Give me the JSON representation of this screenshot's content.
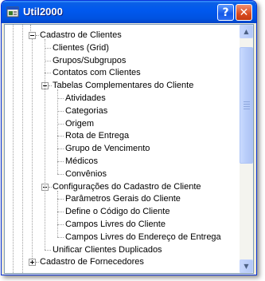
{
  "window": {
    "title": "Util2000",
    "help_label": "?",
    "close_label": "✕"
  },
  "colors": {
    "titlebar": "#0058ee",
    "tree_bg": "#ffffff",
    "lines": "#a0a0a0"
  },
  "tree": {
    "items": [
      {
        "label": "Cadastro de Clientes",
        "level": 0,
        "expander": "minus"
      },
      {
        "label": "Clientes (Grid)",
        "level": 1,
        "expander": ""
      },
      {
        "label": "Grupos/Subgrupos",
        "level": 1,
        "expander": ""
      },
      {
        "label": "Contatos com Clientes",
        "level": 1,
        "expander": ""
      },
      {
        "label": "Tabelas Complementares do Cliente",
        "level": 1,
        "expander": "minus"
      },
      {
        "label": "Atividades",
        "level": 2,
        "expander": ""
      },
      {
        "label": "Categorias",
        "level": 2,
        "expander": ""
      },
      {
        "label": "Origem",
        "level": 2,
        "expander": ""
      },
      {
        "label": "Rota de Entrega",
        "level": 2,
        "expander": ""
      },
      {
        "label": "Grupo de Vencimento",
        "level": 2,
        "expander": ""
      },
      {
        "label": "Médicos",
        "level": 2,
        "expander": ""
      },
      {
        "label": "Convênios",
        "level": 2,
        "expander": ""
      },
      {
        "label": "Configurações do Cadastro de Cliente",
        "level": 1,
        "expander": "minus"
      },
      {
        "label": "Parâmetros Gerais do Cliente",
        "level": 2,
        "expander": ""
      },
      {
        "label": "Define o Código do Cliente",
        "level": 2,
        "expander": ""
      },
      {
        "label": "Campos Livres do Cliente",
        "level": 2,
        "expander": ""
      },
      {
        "label": "Campos Livres do Endereço de Entrega",
        "level": 2,
        "expander": ""
      },
      {
        "label": "Unificar Clientes Duplicados",
        "level": 1,
        "expander": ""
      },
      {
        "label": "Cadastro de Fornecedores",
        "level": 0,
        "expander": "plus"
      }
    ]
  },
  "scrollbar": {
    "up_icon": "▲",
    "down_icon": "▼",
    "position_fraction": 0.08,
    "visible_fraction": 0.47
  }
}
